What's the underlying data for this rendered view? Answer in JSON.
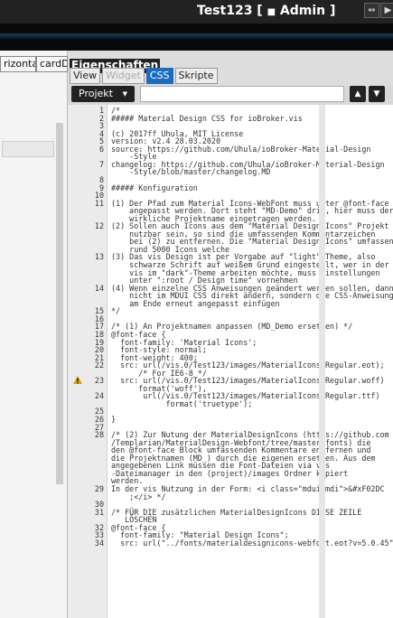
{
  "window": {
    "title": "Test123 [",
    "user": "Admin",
    "title_end": "]"
  },
  "left_panel": {
    "tabs": [
      "rizontal",
      "cardD"
    ]
  },
  "properties": {
    "header": "Eigenschaften",
    "tabs": [
      {
        "label": "View",
        "state": "normal"
      },
      {
        "label": "Widget",
        "state": "disabled"
      },
      {
        "label": "CSS",
        "state": "active"
      },
      {
        "label": "Skripte",
        "state": "normal"
      }
    ],
    "project_select": "Projekt",
    "search_value": ""
  },
  "code": [
    {
      "n": "1",
      "t": "/*"
    },
    {
      "n": "2",
      "t": "##### Material Design CSS for ioBroker.vis"
    },
    {
      "n": "3",
      "t": ""
    },
    {
      "n": "4",
      "t": "(c) 2017ff Uhula, MIT License"
    },
    {
      "n": "5",
      "t": "version: v2.4 28.03.2020"
    },
    {
      "n": "6",
      "t": "source: https://github.com/Uhula/ioBroker-Material-Design"
    },
    {
      "n": "",
      "t": "    -Style"
    },
    {
      "n": "7",
      "t": "changelog: https://github.com/Uhula/ioBroker-Material-Design"
    },
    {
      "n": "",
      "t": "    -Style/blob/master/changelog.MD"
    },
    {
      "n": "8",
      "t": ""
    },
    {
      "n": "9",
      "t": "##### Konfiguration"
    },
    {
      "n": "10",
      "t": ""
    },
    {
      "n": "11",
      "t": "(1) Der Pfad zum Material Icons-WebFont muss unter @font-face"
    },
    {
      "n": "",
      "t": "    angepasst werden. Dort steht \"MD-Demo\" drin, hier muss der"
    },
    {
      "n": "",
      "t": "    wirkliche Projektname eingetragen werden."
    },
    {
      "n": "12",
      "t": "(2) Sollen auch Icons aus dem \"Material Design Icons\" Projekt"
    },
    {
      "n": "",
      "t": "    nutzbar sein, so sind die umfassenden Kommentarzeichen"
    },
    {
      "n": "",
      "t": "    bei (2) zu entfernen. Die \"Material Design Icons\" umfassen"
    },
    {
      "n": "",
      "t": "    rund 5000 Icons welche"
    },
    {
      "n": "13",
      "t": "(3) Das vis Design ist per Vorgabe auf \"light\"-Theme, also"
    },
    {
      "n": "",
      "t": "    schwarze Schrift auf weißem Grund eingestellt, wer in der"
    },
    {
      "n": "",
      "t": "    vis im \"dark\"-Theme arbeiten möchte, muss Einstellungen"
    },
    {
      "n": "",
      "t": "    unter \":root / Design time\" vornehmen"
    },
    {
      "n": "14",
      "t": "(4) Wenn einzelne CSS Anweisungen geändert werden sollen, dann"
    },
    {
      "n": "",
      "t": "    nicht im MDUI CSS direkt ändern, sondern die CSS-Anweisung"
    },
    {
      "n": "",
      "t": "    am Ende erneut angepasst einfügen"
    },
    {
      "n": "15",
      "t": "*/"
    },
    {
      "n": "16",
      "t": ""
    },
    {
      "n": "17",
      "t": "/* (1) An Projektnamen anpassen (MD_Demo ersetzen) */"
    },
    {
      "n": "18",
      "t": "@font-face {"
    },
    {
      "n": "19",
      "t": "  font-family: 'Material Icons';"
    },
    {
      "n": "20",
      "t": "  font-style: normal;"
    },
    {
      "n": "21",
      "t": "  font-weight: 400;"
    },
    {
      "n": "22",
      "t": "  src: url(/vis.0/Test123/images/MaterialIcons-Regular.eot);"
    },
    {
      "n": "",
      "t": "      /* For IE6-8 */"
    },
    {
      "n": "23",
      "t": "  src: url(/vis.0/Test123/images/MaterialIcons-Regular.woff)"
    },
    {
      "n": "",
      "t": "      format('woff'),"
    },
    {
      "n": "24",
      "t": "       url(/vis.0/Test123/images/MaterialIcons-Regular.ttf)"
    },
    {
      "n": "",
      "t": "            format('truetype');"
    },
    {
      "n": "25",
      "t": ""
    },
    {
      "n": "26",
      "t": "}"
    },
    {
      "n": "27",
      "t": ""
    },
    {
      "n": "28",
      "t": "/* (2) Zur Nutung der MaterialDesignIcons (https://github.com"
    },
    {
      "n": "",
      "t": "/Templarian/MaterialDesign-Webfont/tree/master/fonts) die"
    },
    {
      "n": "",
      "t": "den @font-face Block umfassenden Kommentare entfernen und"
    },
    {
      "n": "",
      "t": "die Projektnamen (MD_) durch die eigenen ersetzen. Aus dem"
    },
    {
      "n": "",
      "t": "angegebenen Link müssen die Font-Dateien via vis"
    },
    {
      "n": "",
      "t": "-Dateimanager in den (project)/images Ordner kopiert"
    },
    {
      "n": "",
      "t": "werden."
    },
    {
      "n": "29",
      "t": "In der vis Nutzung in der Form: <i class=\"mdui-mdi\">&#xF02DC"
    },
    {
      "n": "",
      "t": "    ;</i> */"
    },
    {
      "n": "30",
      "t": ""
    },
    {
      "n": "31",
      "t": "/* FÜR DIE zusätzlichen MaterialDesignIcons DIESE ZEILE"
    },
    {
      "n": "",
      "t": "   LÖSCHEN"
    },
    {
      "n": "32",
      "t": "@font-face {"
    },
    {
      "n": "33",
      "t": "  font-family: \"Material Design Icons\";"
    },
    {
      "n": "34",
      "t": "  src: url(\"../fonts/materialdesignicons-webfont.eot?v=5.0.45\""
    }
  ]
}
